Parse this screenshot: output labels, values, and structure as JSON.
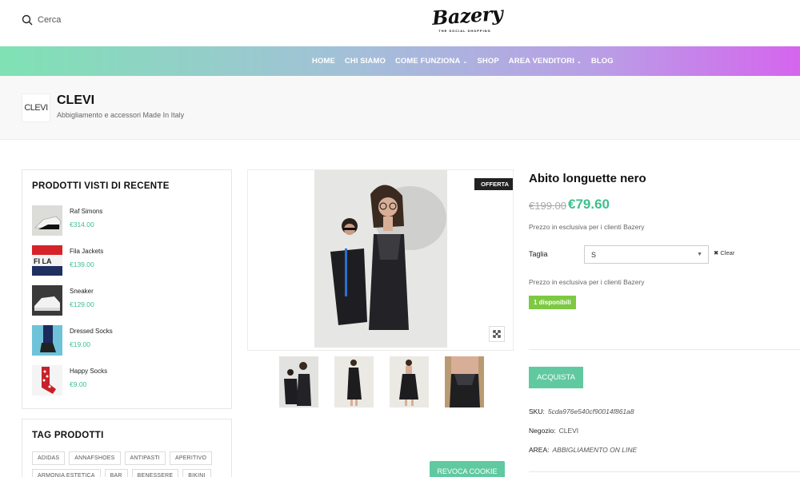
{
  "header": {
    "search_label": "Cerca",
    "logo_text": "Bazery",
    "logo_tagline": "THE SOCIAL SHOPPING"
  },
  "nav": {
    "items": [
      {
        "label": "HOME"
      },
      {
        "label": "CHI SIAMO"
      },
      {
        "label": "COME FUNZIONA",
        "dropdown": true
      },
      {
        "label": "SHOP"
      },
      {
        "label": "AREA VENDITORI",
        "dropdown": true
      },
      {
        "label": "BLOG"
      }
    ],
    "gradient_colors": [
      "#7fe2b4",
      "#a4bfd9",
      "#b99ee6",
      "#d565ee"
    ]
  },
  "vendor": {
    "logo_text": "CLEVI",
    "name": "CLEVI",
    "description": "Abbigliamento e accessori Made In Italy"
  },
  "sidebar": {
    "recent_title": "PRODOTTI VISTI DI RECENTE",
    "recent_items": [
      {
        "name": "Raf Simons",
        "price": "€314.00"
      },
      {
        "name": "Fila Jackets",
        "price": "€139.00"
      },
      {
        "name": "Sneaker",
        "price": "€129.00"
      },
      {
        "name": "Dressed Socks",
        "price": "€19.00"
      },
      {
        "name": "Happy Socks",
        "price": "€9.00"
      }
    ],
    "tags_title": "TAG PRODOTTI",
    "tags": [
      "ADIDAS",
      "ANNAFSHOES",
      "ANTIPASTI",
      "APERITIVO",
      "ARMONIA ESTETICA",
      "BAR",
      "BENESSERE",
      "BIKINI"
    ]
  },
  "gallery": {
    "badge": "OFFERTA",
    "thumb_count": 4
  },
  "product": {
    "title": "Abito longuette nero",
    "old_price": "€199.00",
    "new_price": "€79.60",
    "exclusive_note": "Prezzo in esclusiva per i clienti Bazery",
    "size_label": "Taglia",
    "size_selected": "S",
    "clear_label": "Clear",
    "stock": "1 disponibili",
    "buy_label": "ACQUISTA",
    "sku_label": "SKU:",
    "sku_value": "5cda976e540cf90014f861a8",
    "shop_label": "Negozio:",
    "shop_value": "CLEVI",
    "area_label": "AREA:",
    "area_value": "ABBIGLIAMENTO ON LINE"
  },
  "cookie": {
    "label": "REVOCA COOKIE"
  },
  "colors": {
    "price_green": "#3cbf8d",
    "button_green": "#60c9a0",
    "stock_green": "#7dc942"
  }
}
